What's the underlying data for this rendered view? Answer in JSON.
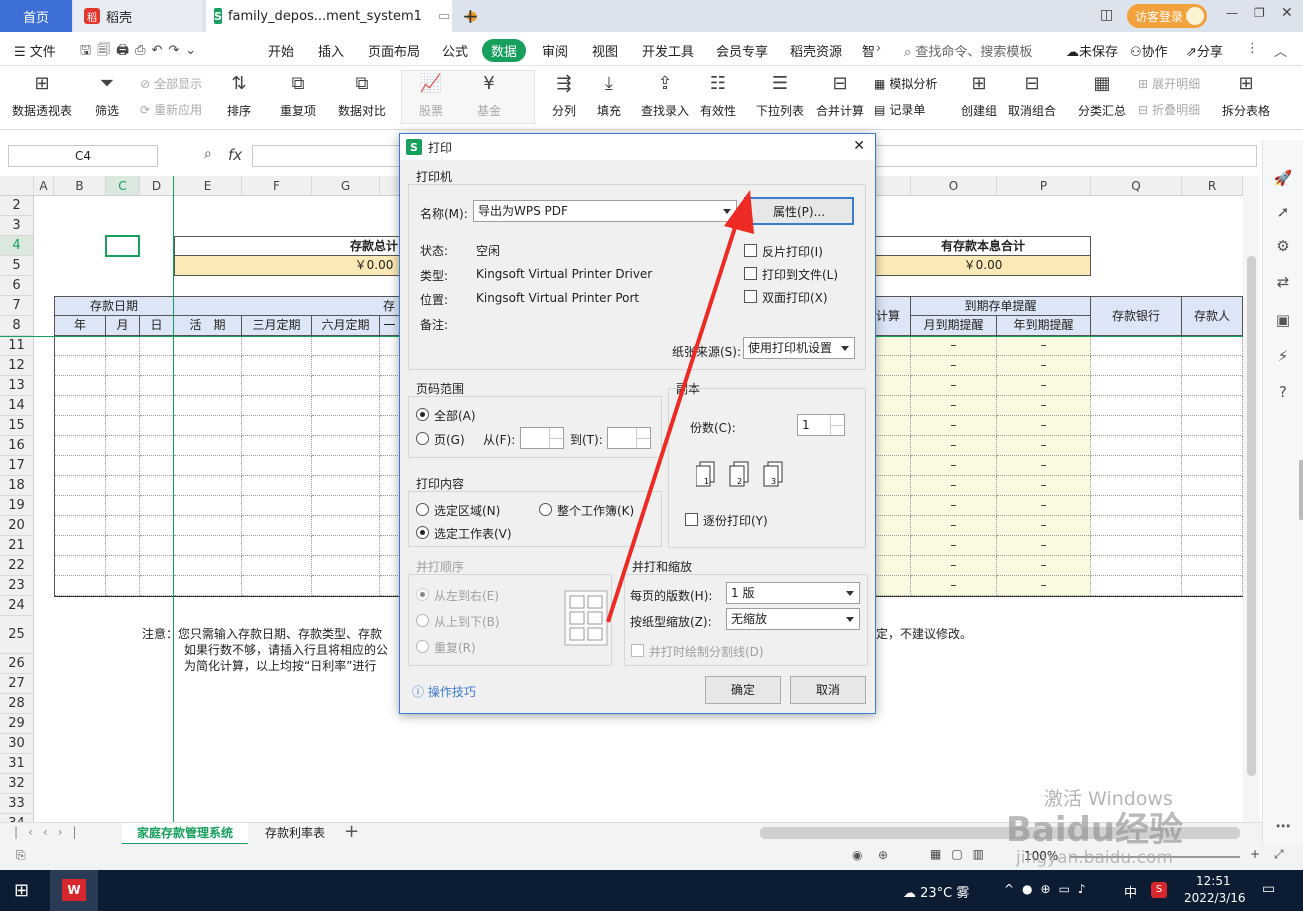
{
  "tabs": {
    "home": "首页",
    "daoke": "稻壳",
    "doc": "family_depos...ment_system1"
  },
  "login": "访客登录",
  "menu": {
    "file": "文件",
    "items": [
      "开始",
      "插入",
      "页面布局",
      "公式",
      "数据",
      "审阅",
      "视图",
      "开发工具",
      "会员专享",
      "稻壳资源",
      "智"
    ],
    "search": "查找命令、搜索模板",
    "unsaved": "未保存",
    "collab": "协作",
    "share": "分享"
  },
  "toolbar": {
    "pivot": "数据透视表",
    "filter": "筛选",
    "showall": "全部显示",
    "reapply": "重新应用",
    "sort": "排序",
    "dup": "重复项",
    "compare": "数据对比",
    "stock": "股票",
    "fund": "基金",
    "split": "分列",
    "fill": "填充",
    "lookup": "查找录入",
    "valid": "有效性",
    "dropdown": "下拉列表",
    "merge": "合并计算",
    "simulate": "模拟分析",
    "record": "记录单",
    "group": "创建组",
    "ungroup": "取消组合",
    "subtotal": "分类汇总",
    "expand": "展开明细",
    "collapse": "折叠明细",
    "splittable": "拆分表格"
  },
  "namebox": "C4",
  "fx": "fx",
  "sheet": {
    "cols": [
      "A",
      "B",
      "C",
      "D",
      "E",
      "F",
      "G",
      "O",
      "P",
      "Q",
      "R"
    ],
    "rows": [
      "2",
      "3",
      "4",
      "5",
      "6",
      "7",
      "8",
      "11",
      "12",
      "13",
      "14",
      "15",
      "16",
      "17",
      "18",
      "19",
      "20",
      "21",
      "22",
      "23",
      "24",
      "25",
      "26",
      "27",
      "28",
      "29",
      "30",
      "31",
      "32",
      "33",
      "34"
    ],
    "total_title": "存款总计",
    "total_value": "￥0.00",
    "all_title": "有存款本息合计",
    "all_value": "￥0.00",
    "h_date": "存款日期",
    "h_deposit": "存",
    "h_calc": "计算",
    "h_remind": "到期存单提醒",
    "h_bank": "存款银行",
    "h_person": "存款人",
    "h_year": "年",
    "h_month": "月",
    "h_day": "日",
    "h_current": "活　期",
    "h_3m": "三月定期",
    "h_6m": "六月定期",
    "h_1": "一",
    "h_monthly": "月到期提醒",
    "h_yearly": "年到期提醒",
    "dash": "–",
    "note1": "注意：您只需输入存款日期、存款类型、存款",
    "note2": "如果行数不够，请插入行且将相应的公",
    "note3": "为简化计算，以上均按“日利率”进行",
    "note_right": "定，不建议修改。"
  },
  "sheettabs": [
    "家庭存款管理系统",
    "存款利率表"
  ],
  "status": {
    "zoom": "100%"
  },
  "taskbar": {
    "weather": "23°C 雾",
    "ime": "中",
    "time": "12:51",
    "date": "2022/3/16"
  },
  "watermark": {
    "activate": "激活 Windows",
    "baidu": "Baidu经验",
    "url": "jingyan.baidu.com"
  },
  "dialog": {
    "title": "打印",
    "printer_group": "打印机",
    "name_label": "名称(M):",
    "name_value": "导出为WPS PDF",
    "props_btn": "属性(P)...",
    "status_label": "状态:",
    "status_value": "空闲",
    "type_label": "类型:",
    "type_value": "Kingsoft Virtual Printer Driver",
    "loc_label": "位置:",
    "loc_value": "Kingsoft Virtual Printer Port",
    "note_label": "备注:",
    "reverse": "反片打印(I)",
    "tofile": "打印到文件(L)",
    "duplex": "双面打印(X)",
    "paper_label": "纸张来源(S):",
    "paper_value": "使用打印机设置",
    "range_group": "页码范围",
    "all": "全部(A)",
    "pages": "页(G)",
    "from": "从(F):",
    "to": "到(T):",
    "copies_group": "副本",
    "copies_label": "份数(C):",
    "copies_value": "1",
    "collate": "逐份打印(Y)",
    "content_group": "打印内容",
    "sel_area": "选定区域(N)",
    "workbook": "整个工作簿(K)",
    "sel_sheet": "选定工作表(V)",
    "order_group": "并打顺序",
    "ltr": "从左到右(E)",
    "ttb": "从上到下(B)",
    "repeat": "重复(R)",
    "scale_group": "并打和缩放",
    "perpage_label": "每页的版数(H):",
    "perpage_value": "1 版",
    "scale_label": "按纸型缩放(Z):",
    "scale_value": "无缩放",
    "cutline": "并打时绘制分割线(D)",
    "tips": "操作技巧",
    "ok": "确定",
    "cancel": "取消"
  }
}
